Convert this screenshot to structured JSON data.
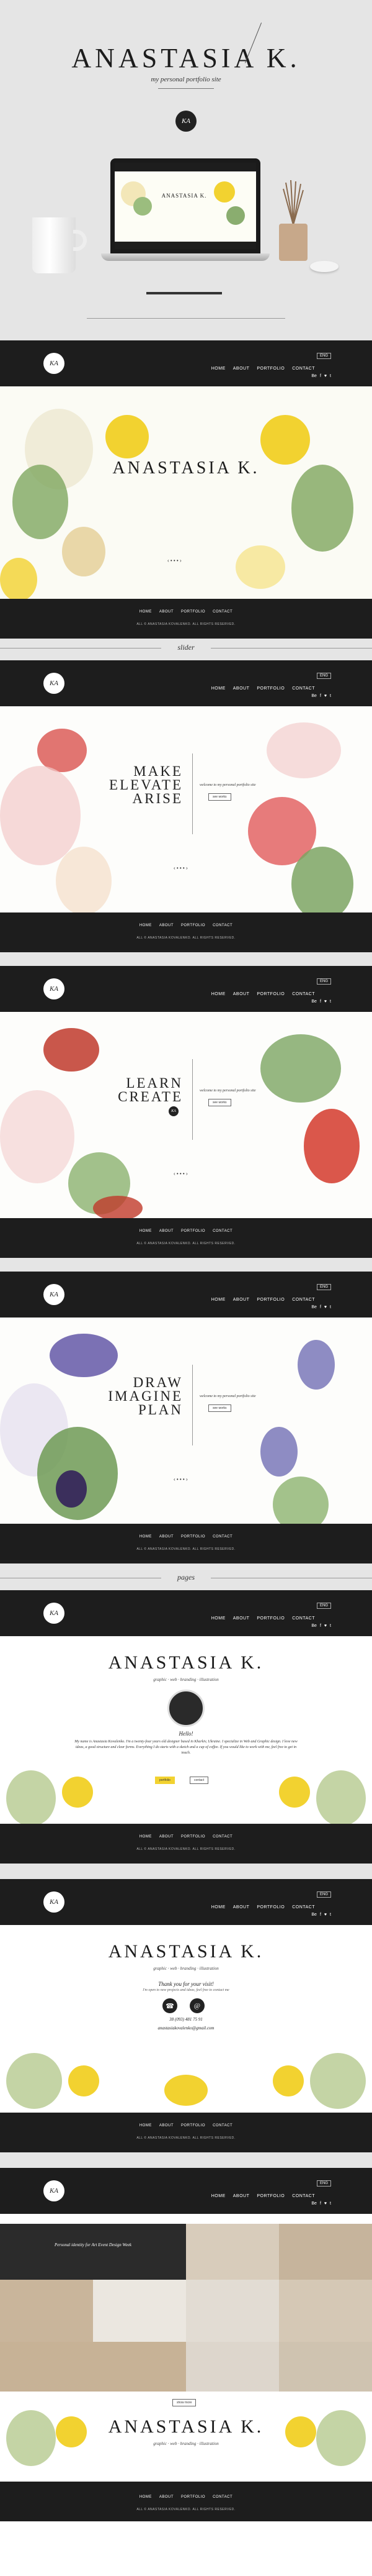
{
  "hero": {
    "title": "ANASTASIA K.",
    "subtitle": "my personal portfolio site",
    "logo_text": "KA"
  },
  "nav": {
    "links": [
      "HOME",
      "ABOUT",
      "PORTFOLIO",
      "CONTACT"
    ],
    "lang": "ENG",
    "social": [
      "Be",
      "f",
      "♥",
      "t"
    ],
    "logo_text": "KA"
  },
  "footer": {
    "links": [
      "HOME",
      "ABOUT",
      "PORTFOLIO",
      "CONTACT"
    ],
    "copyright": "ALL © ANASTASIA KOVALENKO. ALL RIGHTS RESERVED."
  },
  "frame1": {
    "title": "ANASTASIA K.",
    "slider_dots": "‹ • • • ›"
  },
  "section_labels": {
    "slider": "slider",
    "pages": "pages"
  },
  "slide1": {
    "lines": [
      "MAKE",
      "ELEVATE",
      "ARISE"
    ],
    "caption": "welcome to my personal portfolio site",
    "button": "see works",
    "slider_dots": "‹ • • • ›"
  },
  "slide2": {
    "lines": [
      "LEARN",
      "CREATE"
    ],
    "caption": "welcome to my personal portfolio site",
    "button": "see works",
    "slider_dots": "‹ • • • ›"
  },
  "slide3": {
    "lines": [
      "DRAW",
      "IMAGINE",
      "PLAN"
    ],
    "caption": "welcome to my personal portfolio site",
    "button": "see works",
    "slider_dots": "‹ • • • ›"
  },
  "about_page": {
    "title": "ANASTASIA K.",
    "subtitle": "graphic · web · branding · illustration",
    "greeting": "Hello!",
    "paragraph": "My name is Anastasia Kovalenko. I'm a twenty-four years old designer based in Kharkiv, Ukraine. I specialize in Web and Graphic design. I love new ideas, a good structure and clear forms. Everything I do starts with a sketch and a cup of coffee. If you would like to work with me, feel free to get in touch.",
    "btn_primary": "portfolio",
    "btn_secondary": "contact"
  },
  "contact_page": {
    "title": "ANASTASIA K.",
    "subtitle": "graphic · web · branding · illustration",
    "thanks": "Thank you for your visit!",
    "thanks_sub": "I'm open to new projects and ideas, feel free to contact me",
    "phone_icon": "phone-icon",
    "mail_icon": "mail-icon",
    "phone": "38 (093) 481 75 91",
    "email": "anastasiakovalenko@gmail.com"
  },
  "portfolio_page": {
    "tile_caption": "Personal identity for Art Event Design Week",
    "more_button": "show more",
    "title": "ANASTASIA K.",
    "subtitle": "graphic · web · branding · illustration"
  },
  "colors": {
    "nav_bg": "#1d1d1d",
    "page_bg": "#e5e5e5",
    "accent_yellow": "#f2d230",
    "rose": "#e58b8b"
  }
}
